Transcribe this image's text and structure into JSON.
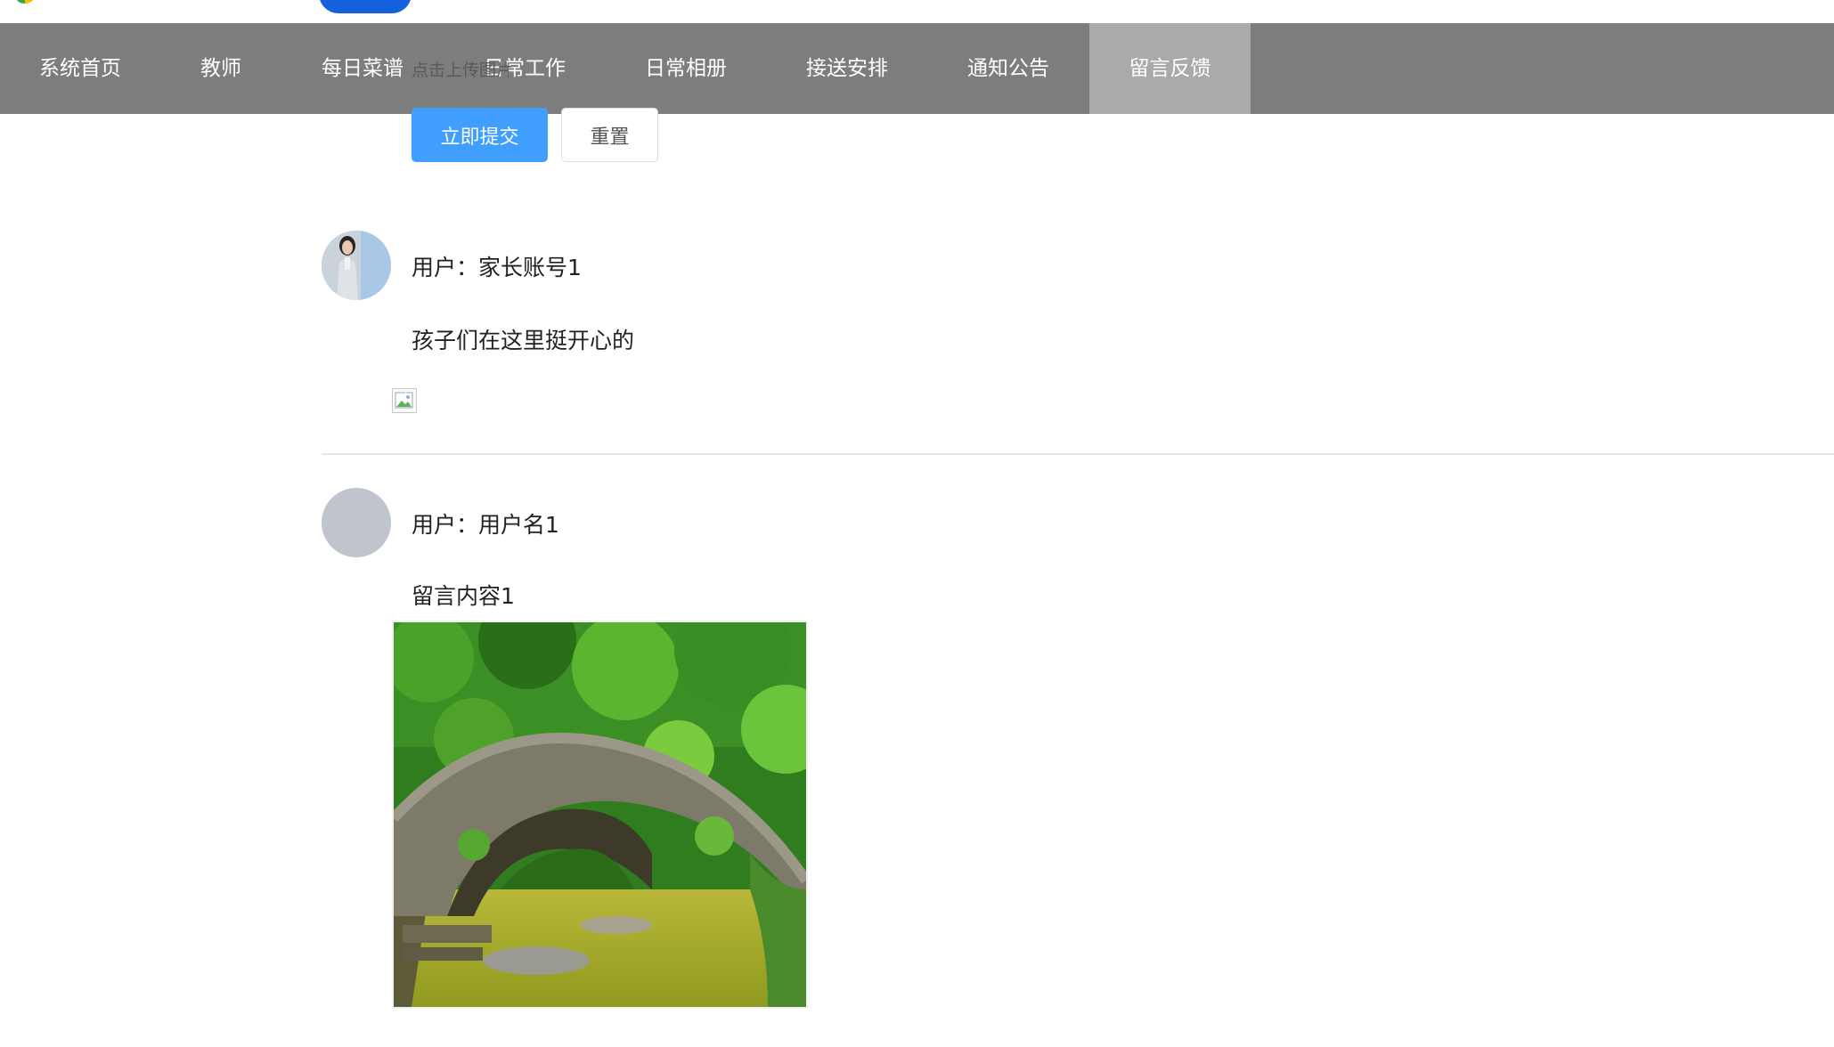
{
  "nav": {
    "items": [
      {
        "label": "系统首页",
        "active": false
      },
      {
        "label": "教师",
        "active": false
      },
      {
        "label": "每日菜谱",
        "active": false
      },
      {
        "label": "日常工作",
        "active": false
      },
      {
        "label": "日常相册",
        "active": false
      },
      {
        "label": "接送安排",
        "active": false
      },
      {
        "label": "通知公告",
        "active": false
      },
      {
        "label": "留言反馈",
        "active": true
      }
    ]
  },
  "form": {
    "upload_hint": "点击上传图片",
    "submit_label": "立即提交",
    "reset_label": "重置"
  },
  "comments": [
    {
      "user": "用户：家长账号1",
      "content": "孩子们在这里挺开心的",
      "image": "broken-image-icon"
    },
    {
      "user": "用户：用户名1",
      "content": "留言内容1",
      "image": "stone-arch-bridge-photo"
    }
  ],
  "colors": {
    "nav_bg": "#7d7d7d",
    "nav_active_bg": "#aaaaaa",
    "primary": "#409eff"
  }
}
